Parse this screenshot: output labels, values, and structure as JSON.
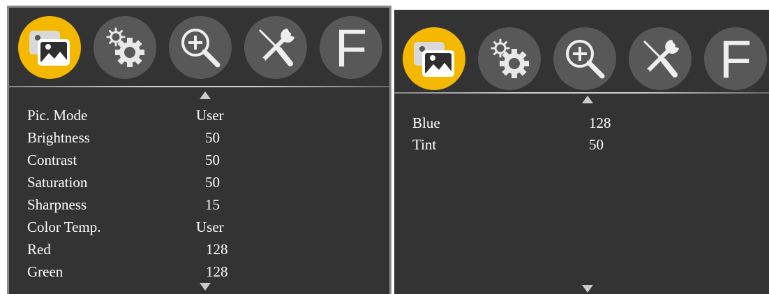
{
  "left_panel": {
    "tabs": [
      {
        "name": "picture",
        "icon": "picture-icon",
        "active": true
      },
      {
        "name": "settings",
        "icon": "gears-icon",
        "active": false
      },
      {
        "name": "zoom",
        "icon": "zoom-in-icon",
        "active": false
      },
      {
        "name": "tools",
        "icon": "tools-icon",
        "active": false
      },
      {
        "name": "function",
        "icon": "F",
        "active": false
      }
    ],
    "rows": [
      {
        "label": "Pic. Mode",
        "value": "User"
      },
      {
        "label": "Brightness",
        "value": "50"
      },
      {
        "label": "Contrast",
        "value": "50"
      },
      {
        "label": "Saturation",
        "value": "50"
      },
      {
        "label": "Sharpness",
        "value": "15"
      },
      {
        "label": "Color Temp.",
        "value": "User"
      },
      {
        "label": "Red",
        "value": "128"
      },
      {
        "label": "Green",
        "value": "128"
      }
    ]
  },
  "right_panel": {
    "tabs": [
      {
        "name": "picture",
        "icon": "picture-icon",
        "active": true
      },
      {
        "name": "settings",
        "icon": "gears-icon",
        "active": false
      },
      {
        "name": "zoom",
        "icon": "zoom-in-icon",
        "active": false
      },
      {
        "name": "tools",
        "icon": "tools-icon",
        "active": false
      },
      {
        "name": "function",
        "icon": "F",
        "active": false
      }
    ],
    "rows": [
      {
        "label": "Blue",
        "value": "128"
      },
      {
        "label": "Tint",
        "value": "50"
      }
    ]
  },
  "colors": {
    "panel_bg": "#333333",
    "active_tab": "#f5b800",
    "inactive_tab": "#585858",
    "text": "#ffffff"
  },
  "function_tab_letter": "F"
}
